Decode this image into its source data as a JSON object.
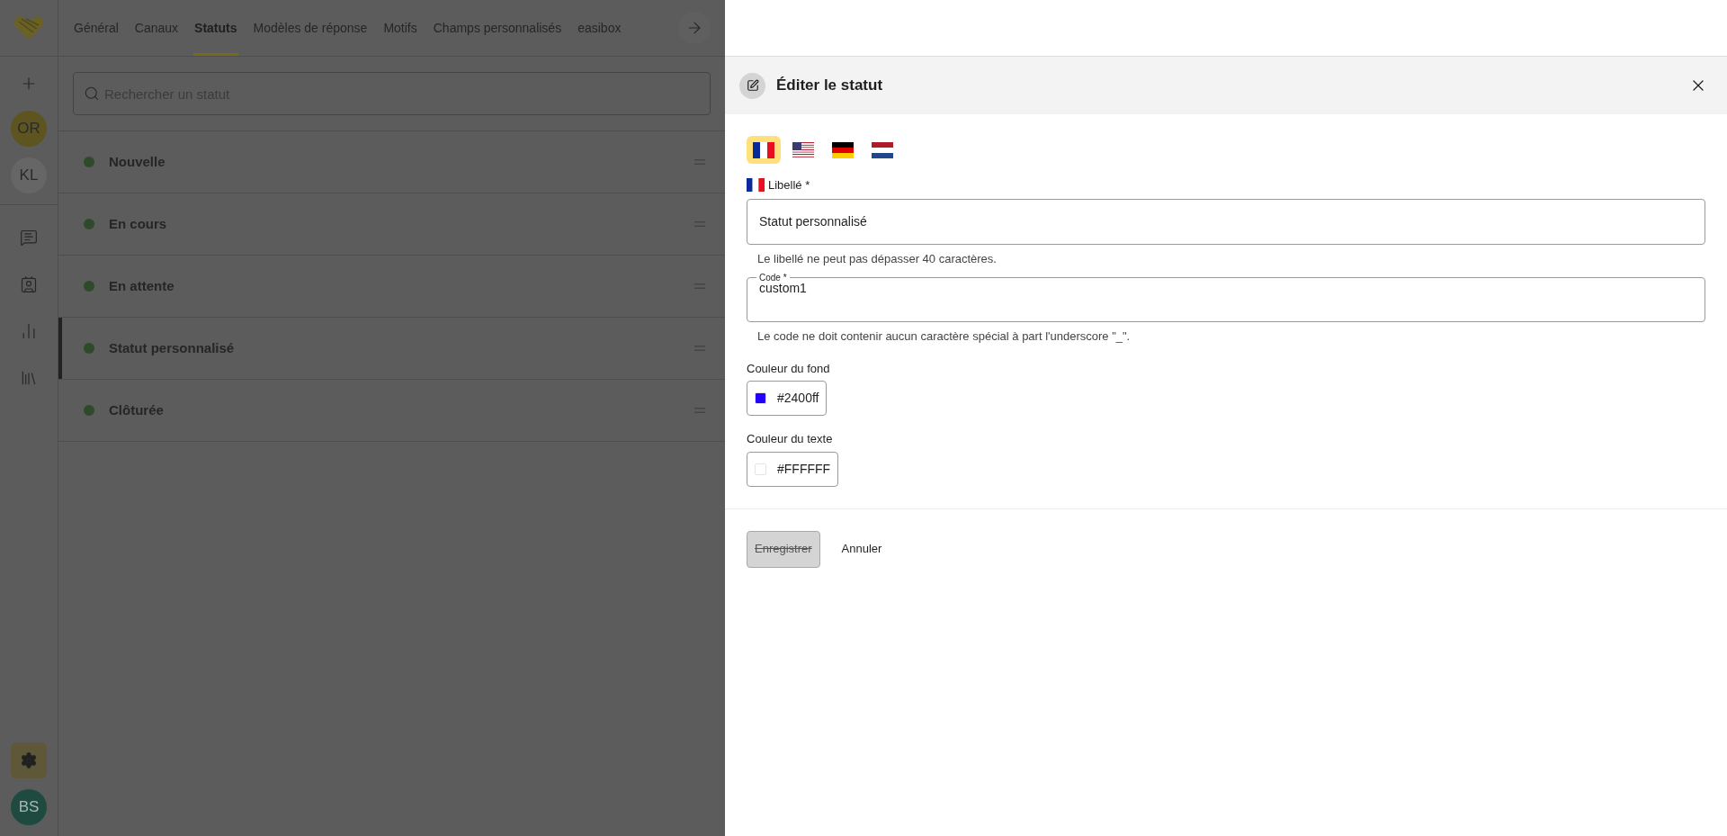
{
  "sidebar": {
    "nav_top": [
      {
        "kind": "add"
      }
    ],
    "avatars": [
      {
        "initials": "OR",
        "color": "#5e5420"
      },
      {
        "initials": "KL",
        "color": "#666666"
      }
    ],
    "nav": [
      {
        "kind": "chat",
        "selected": false
      },
      {
        "kind": "contacts",
        "selected": false
      },
      {
        "kind": "stats",
        "selected": false
      },
      {
        "kind": "library",
        "selected": false
      }
    ],
    "settings": {
      "selected": true
    },
    "user": {
      "initials": "BS",
      "color": "#1f4a40"
    }
  },
  "tabs": [
    {
      "label": "Général",
      "selected": false
    },
    {
      "label": "Canaux",
      "selected": false
    },
    {
      "label": "Statuts",
      "selected": true
    },
    {
      "label": "Modèles de réponse",
      "selected": false
    },
    {
      "label": "Motifs",
      "selected": false
    },
    {
      "label": "Champs personnalisés",
      "selected": false
    },
    {
      "label": "easibox",
      "selected": false
    }
  ],
  "search": {
    "placeholder": "Rechercher un statut"
  },
  "statuses": [
    {
      "name": "Nouvelle",
      "selected": false,
      "color": "#2f4a2a"
    },
    {
      "name": "En cours",
      "selected": false,
      "color": "#2f4a2a"
    },
    {
      "name": "En attente",
      "selected": false,
      "color": "#2f4a2a"
    },
    {
      "name": "Statut personnalisé",
      "selected": true,
      "color": "#2f4a2a"
    },
    {
      "name": "Clôturée",
      "selected": false,
      "color": "#2f4a2a"
    }
  ],
  "drawer": {
    "title": "Éditer le statut",
    "languages": [
      {
        "kind": "fr",
        "selected": true
      },
      {
        "kind": "us",
        "selected": false
      },
      {
        "kind": "de",
        "selected": false
      },
      {
        "kind": "nl",
        "selected": false
      }
    ],
    "label_field": {
      "label": "Libellé *",
      "value": "Statut personnalisé",
      "help": "Le libellé ne peut pas dépasser 40 caractères."
    },
    "code_field": {
      "label": "Code *",
      "value": "custom1",
      "help": "Le code ne doit contenir aucun caractère spécial à part l'underscore \"_\"."
    },
    "background_color": {
      "label": "Couleur du fond",
      "value": "#2400ff"
    },
    "text_color": {
      "label": "Couleur du texte",
      "value": "#FFFFFF"
    },
    "save_button": {
      "label": "Enregistrer",
      "disabled": true
    },
    "cancel_button": {
      "label": "Annuler"
    }
  }
}
